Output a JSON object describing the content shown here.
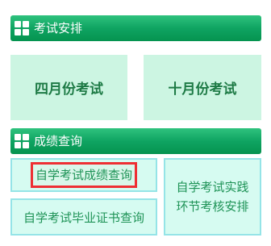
{
  "exam_section": {
    "title": "考试安排",
    "icon": "grid-icon"
  },
  "exam_buttons": {
    "april": "四月份考试",
    "october": "十月份考试"
  },
  "score_section": {
    "title": "成绩查询",
    "icon": "grid-icon"
  },
  "query_buttons": {
    "score_query": "自学考试成绩查询",
    "graduation_cert": "自学考试毕业证书查询",
    "practice_line1": "自学考试实践",
    "practice_line2": "环节考核安排"
  },
  "colors": {
    "bar_green": "#0fa462",
    "card_green": "#ccf5e2",
    "query_bg": "#d6fbf1",
    "query_border": "#95e4e7",
    "highlight_red": "#ee2f33"
  }
}
